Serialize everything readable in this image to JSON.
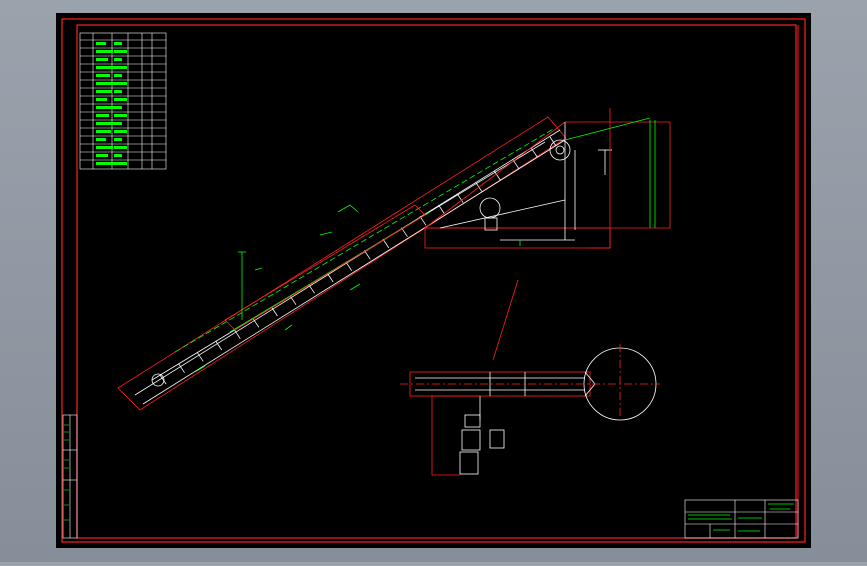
{
  "drawing": {
    "background": "#000000",
    "frame_color": "#ff0000",
    "line_color": "#ffffff",
    "dim_color": "#00ff00",
    "accent_color": "#ff0000"
  },
  "title_block": {
    "title_line": "",
    "scale": "",
    "sheet": ""
  },
  "icons": [
    "zoom-pan-canvas"
  ]
}
